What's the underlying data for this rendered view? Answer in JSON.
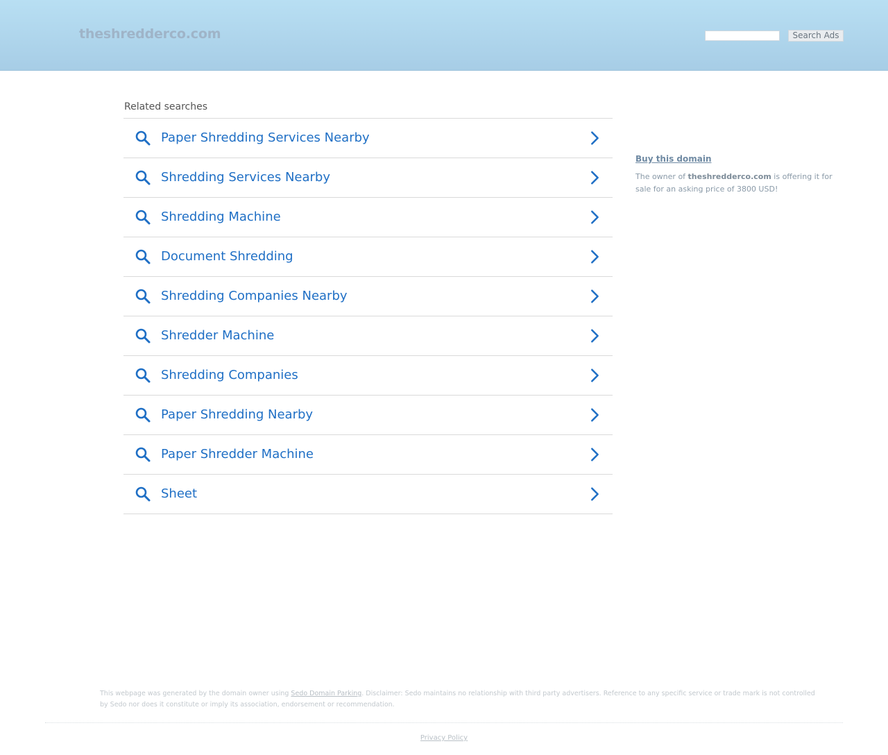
{
  "header": {
    "site_title": "theshredderco.com",
    "search_placeholder": "",
    "search_button_label": "Search Ads"
  },
  "related": {
    "heading": "Related searches",
    "items": [
      {
        "label": "Paper Shredding Services Nearby"
      },
      {
        "label": "Shredding Services Nearby"
      },
      {
        "label": "Shredding Machine"
      },
      {
        "label": "Document Shredding"
      },
      {
        "label": "Shredding Companies Nearby"
      },
      {
        "label": "Shredder Machine"
      },
      {
        "label": "Shredding Companies"
      },
      {
        "label": "Paper Shredding Nearby"
      },
      {
        "label": "Paper Shredder Machine"
      },
      {
        "label": "Sheet"
      }
    ]
  },
  "sidebar": {
    "buy_label": "Buy this domain",
    "offer_prefix": "The owner of ",
    "offer_domain": "theshredderco.com",
    "offer_suffix": " is offering it for sale for an asking price of 3800 USD!"
  },
  "footer": {
    "disclaimer_prefix": "This webpage was generated by the domain owner using ",
    "disclaimer_link": "Sedo Domain Parking",
    "disclaimer_suffix": ". Disclaimer: Sedo maintains no relationship with third party advertisers. Reference to any specific service or trade mark is not controlled by Sedo nor does it constitute or imply its association, endorsement or recommendation.",
    "privacy_label": "Privacy Policy"
  },
  "colors": {
    "link_blue": "#1f6fc5",
    "header_top": "#b8dff3",
    "header_bottom": "#a7cde6"
  },
  "icons": {
    "result_left": "search-icon",
    "result_right": "chevron-right-icon"
  }
}
